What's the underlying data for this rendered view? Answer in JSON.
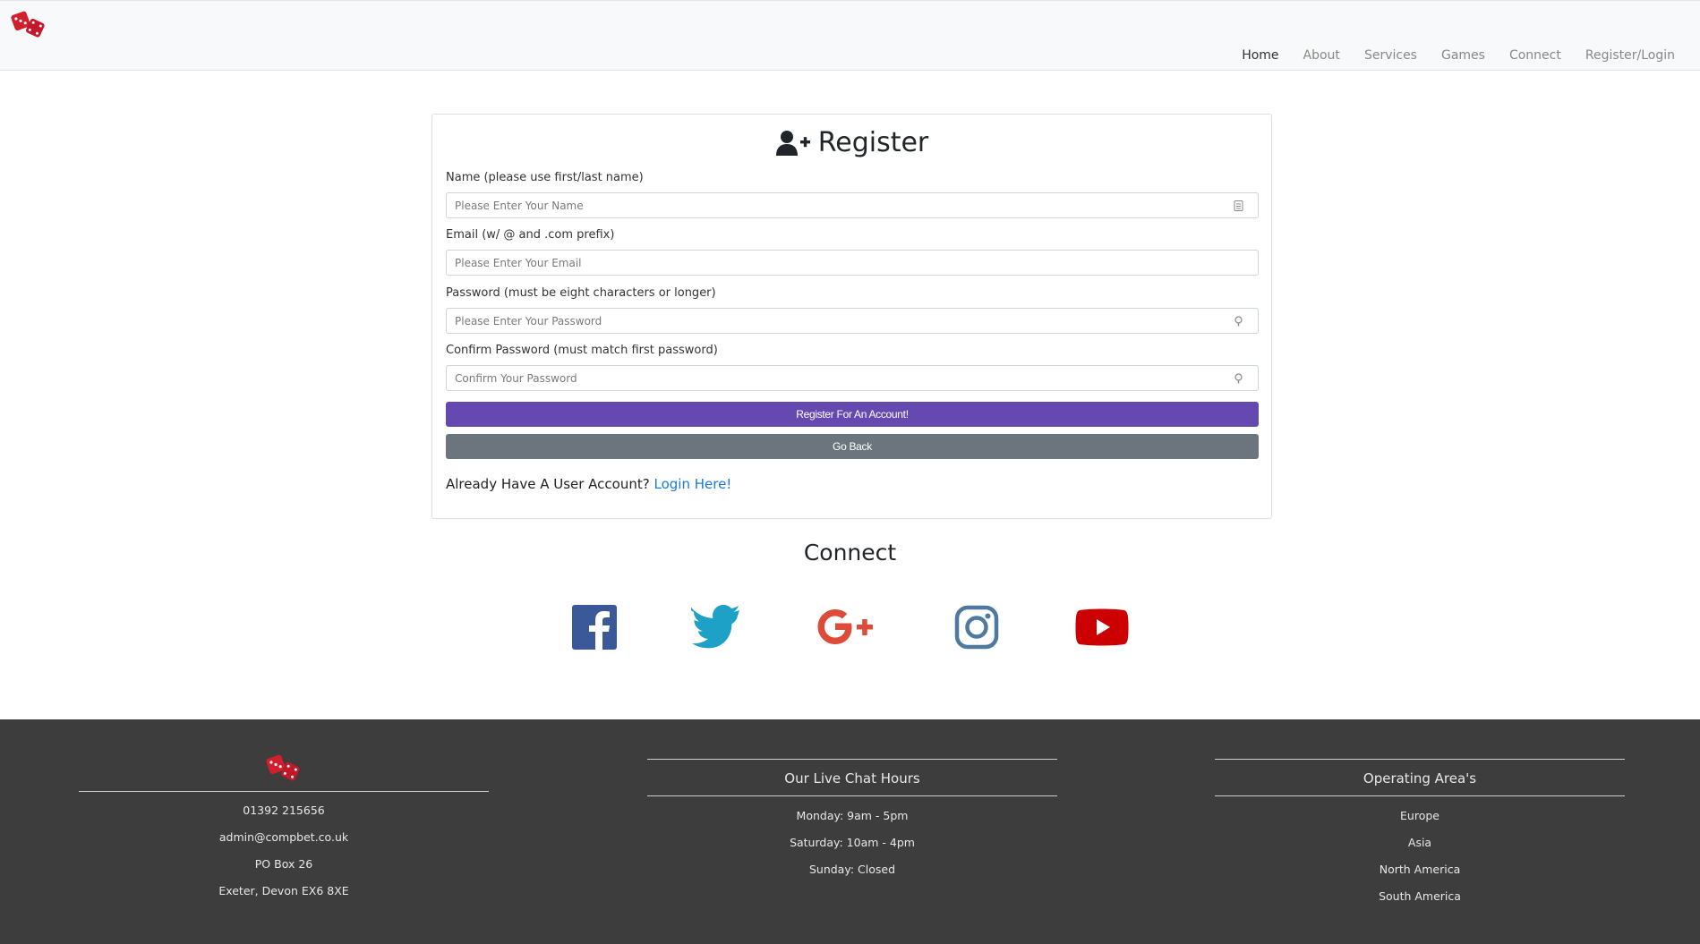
{
  "nav": {
    "logo_icon": "dice-icon",
    "links": [
      "Home",
      "About",
      "Services",
      "Games",
      "Connect",
      "Register/Login"
    ]
  },
  "register": {
    "title": "Register",
    "title_icon": "user-plus-icon",
    "fields": [
      {
        "label": "Name (please use first/last name)",
        "placeholder": "Please Enter Your Name",
        "icon": "contact-card-icon"
      },
      {
        "label": "Email (w/ @ and .com prefix)",
        "placeholder": "Please Enter Your Email",
        "icon": ""
      },
      {
        "label": "Password (must be eight characters or longer)",
        "placeholder": "Please Enter Your Password",
        "icon": "key-icon"
      },
      {
        "label": "Confirm Password (must match first password)",
        "placeholder": "Confirm Your Password",
        "icon": "key-icon"
      }
    ],
    "register_button": "Register For An Account!",
    "back_button": "Go Back",
    "login_prompt": "Already Have A User Account?",
    "login_link": "Login Here!"
  },
  "connect": {
    "title": "Connect",
    "socials": [
      "facebook-icon",
      "twitter-icon",
      "google-plus-icon",
      "instagram-icon",
      "youtube-icon"
    ]
  },
  "footer": {
    "contact": {
      "phone": "01392 215656",
      "email": "admin@compbet.co.uk",
      "po_box": "PO Box 26",
      "city": "Exeter, Devon EX6 8XE"
    },
    "chat_hours": {
      "heading": "Our Live Chat Hours",
      "lines": [
        "Monday: 9am - 5pm",
        "Saturday: 10am - 4pm",
        "Sunday: Closed"
      ]
    },
    "areas": {
      "heading": "Operating Area's",
      "lines": [
        "Europe",
        "Asia",
        "North America",
        "South America"
      ]
    }
  },
  "colors": {
    "primary_button": "#6549b0",
    "secondary_button": "#6c757d",
    "footer_bg": "#3d3d3d",
    "link": "#1a7ae0",
    "dice_red": "#d21f2b"
  }
}
